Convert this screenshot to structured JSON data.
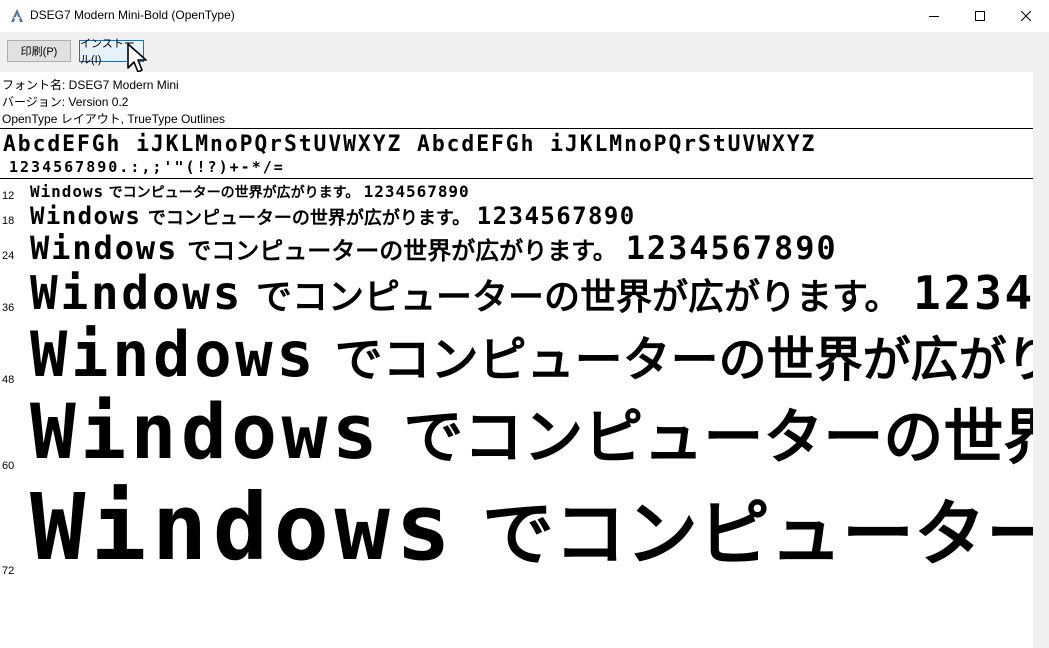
{
  "window": {
    "title": "DSEG7 Modern Mini-Bold (OpenType)"
  },
  "toolbar": {
    "print_label": "印刷(P)",
    "install_label": "インストール(I)"
  },
  "info": {
    "font_name": "フォント名: DSEG7 Modern Mini",
    "version": "バージョン: Version 0.2",
    "type": "OpenType レイアウト, TrueType Outlines"
  },
  "charset": {
    "line1": "AbcdEFGh iJKLMnoPQrStUVWXYZ AbcdEFGh iJKLMnoPQrStUVWXYZ",
    "line2": "1234567890.:,;'\"(!?)+-*/="
  },
  "samples": {
    "latin": "Windows",
    "jp": "でコンピューターの世界が広がります。",
    "digits": "1234567890",
    "rows": [
      {
        "size": "12"
      },
      {
        "size": "18"
      },
      {
        "size": "24"
      },
      {
        "size": "36"
      },
      {
        "size": "48"
      },
      {
        "size": "60"
      },
      {
        "size": "72"
      }
    ]
  }
}
